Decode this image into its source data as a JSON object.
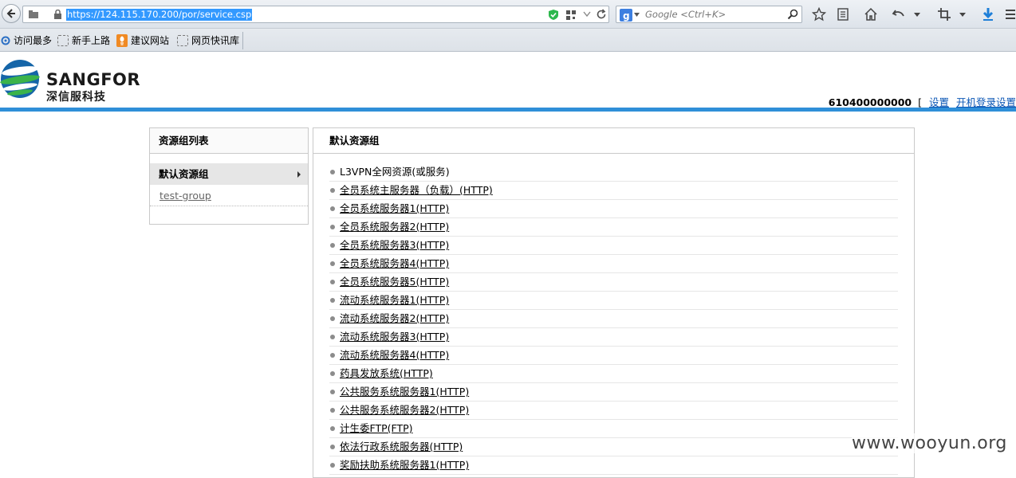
{
  "browser": {
    "url": "https://124.115.170.200/por/service.csp",
    "search_placeholder": "Google <Ctrl+K>"
  },
  "bookmarks": [
    {
      "label": "访问最多"
    },
    {
      "label": "新手上路"
    },
    {
      "label": "建议网站"
    },
    {
      "label": "网页快讯库"
    }
  ],
  "header": {
    "logo_en": "SANGFOR",
    "logo_cn": "深信服科技",
    "user_id": "610400000000",
    "bracket": "[",
    "settings_link": "设置",
    "login_settings_link": "开机登录设置"
  },
  "left_panel": {
    "title": "资源组列表",
    "items": [
      {
        "label": "默认资源组"
      },
      {
        "label": "test-group"
      }
    ]
  },
  "main_panel": {
    "title": "默认资源组",
    "resources": [
      "L3VPN全网资源(或服务)",
      "全员系统主服务器（负载）(HTTP)",
      "全员系统服务器1(HTTP)",
      "全员系统服务器2(HTTP)",
      "全员系统服务器3(HTTP)",
      "全员系统服务器4(HTTP)",
      "全员系统服务器5(HTTP)",
      "流动系统服务器1(HTTP)",
      "流动系统服务器2(HTTP)",
      "流动系统服务器3(HTTP)",
      "流动系统服务器4(HTTP)",
      "药具发放系统(HTTP)",
      "公共服务系统服务器1(HTTP)",
      "公共服务系统服务器2(HTTP)",
      "计生委FTP(FTP)",
      "依法行政系统服务器(HTTP)",
      "奖励扶助系统服务器1(HTTP)"
    ]
  },
  "watermark": "www.wooyun.org"
}
